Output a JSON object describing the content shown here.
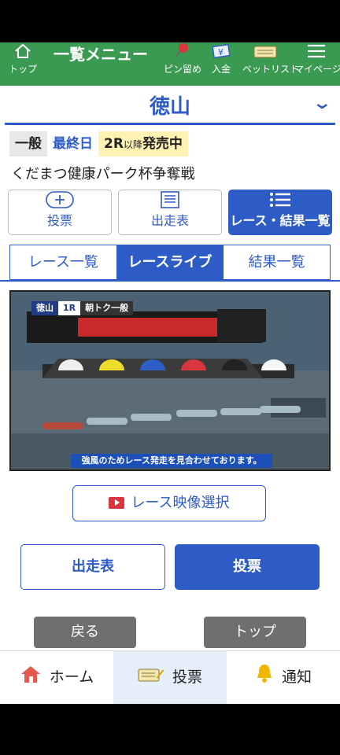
{
  "topnav": {
    "top": {
      "label": "トップ",
      "icon": "home-icon"
    },
    "menu": {
      "label": "一覧メニュー"
    },
    "pin": {
      "label": "ピン留め",
      "icon": "pin-icon"
    },
    "deposit": {
      "label": "入金",
      "icon": "yen-icon"
    },
    "betlist": {
      "label": "ベットリスト",
      "icon": "list-icon"
    },
    "mypage": {
      "label": "マイページ",
      "icon": "hamburger-icon"
    }
  },
  "stadium": {
    "name": "徳山"
  },
  "badges": {
    "grade": "一般",
    "day": "最終日",
    "sale_race": "2R",
    "sale_suffix": "以降",
    "sale_text": "発売中"
  },
  "race_title": "くだまつ健康パーク杯争奪戦",
  "actions": {
    "vote": "投票",
    "entry": "出走表",
    "results": "レース・結果一覧"
  },
  "tabs": [
    "レース一覧",
    "レースライブ",
    "結果一覧"
  ],
  "video": {
    "stadium_tag": "徳山",
    "race_tag": "1R",
    "label_tag": "朝トク一般",
    "caption": "強風のためレース発走を見合わせております。"
  },
  "select_video": "レース映像選択",
  "buttons": {
    "entry": "出走表",
    "vote": "投票",
    "back": "戻る",
    "top": "トップ"
  },
  "tabbar": {
    "home": "ホーム",
    "vote": "投票",
    "notice": "通知"
  },
  "colors": {
    "nav_green": "#3a9a52",
    "accent_blue": "#2e5cc7",
    "sale_yellow": "#fff2b3"
  }
}
